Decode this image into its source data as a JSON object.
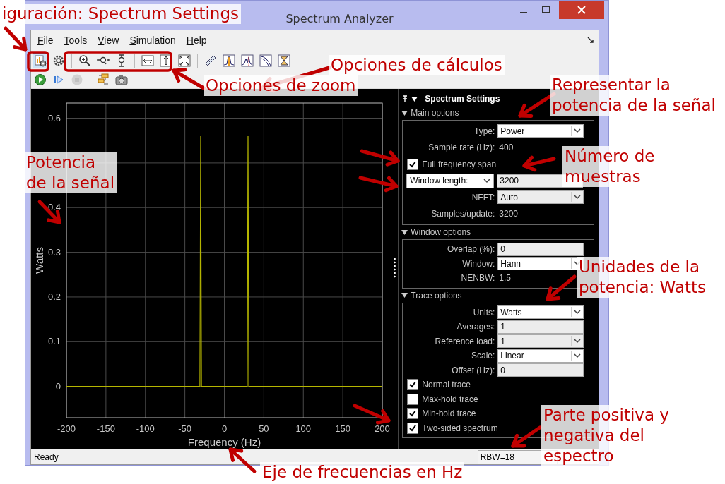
{
  "window": {
    "title": "Spectrum Analyzer"
  },
  "menu": [
    {
      "label": "File"
    },
    {
      "label": "Tools"
    },
    {
      "label": "View"
    },
    {
      "label": "Simulation"
    },
    {
      "label": "Help"
    }
  ],
  "toolbar": {
    "groups": [
      {
        "buttons": [
          {
            "kind": "settings-page",
            "selected": true
          },
          {
            "kind": "gear",
            "selected": false
          }
        ]
      },
      {
        "buttons": [
          {
            "kind": "zoom-in",
            "selected": false
          },
          {
            "kind": "zoom-x",
            "selected": false
          },
          {
            "kind": "zoom-y",
            "selected": false
          }
        ]
      },
      {
        "buttons": [
          {
            "kind": "fit-x",
            "selected": false
          },
          {
            "kind": "fit-y",
            "selected": false
          },
          {
            "kind": "fit-all",
            "selected": false
          }
        ]
      },
      {
        "buttons": [
          {
            "kind": "ruler",
            "selected": false
          },
          {
            "kind": "peak",
            "selected": false
          },
          {
            "kind": "spectrum",
            "selected": false
          },
          {
            "kind": "curve",
            "selected": false
          },
          {
            "kind": "hourglass",
            "selected": false
          }
        ]
      }
    ]
  },
  "run_toolbar": {
    "groups": [
      {
        "buttons": [
          {
            "kind": "run",
            "disabled": false
          },
          {
            "kind": "step",
            "disabled": false
          },
          {
            "kind": "stop",
            "disabled": true
          }
        ]
      },
      {
        "buttons": [
          {
            "kind": "blocks",
            "disabled": false
          },
          {
            "kind": "camera",
            "disabled": false
          }
        ]
      }
    ]
  },
  "plot": {
    "chart_data": {
      "type": "line",
      "xlabel": "Frequency (Hz)",
      "ylabel": "Watts",
      "x": [
        -200,
        -31,
        -30,
        -29,
        29,
        30,
        31,
        200
      ],
      "series": [
        {
          "color": "#b5b500",
          "values": [
            0,
            0,
            0.56,
            0,
            0,
            0.56,
            0,
            0
          ]
        }
      ],
      "xlim": [
        -200,
        200
      ],
      "ylim": [
        -0.07,
        0.634
      ],
      "xticks": [
        -200,
        -150,
        -100,
        -50,
        0,
        50,
        100,
        150,
        200
      ],
      "yticks": [
        0,
        0.1,
        0.2,
        0.3,
        0.4,
        0.6
      ],
      "grid": true
    }
  },
  "settings": {
    "title": "Spectrum Settings",
    "sections": [
      {
        "title": "Main options",
        "expanded": true,
        "rows": [
          {
            "kind": "dropdown",
            "label": "Type:",
            "value": "Power"
          },
          {
            "kind": "readout",
            "label": "Sample rate (Hz):",
            "value": "400"
          },
          {
            "kind": "checkbox",
            "label": "Full frequency span",
            "checked": true
          },
          {
            "kind": "dropdown-input",
            "label": "Window length:",
            "value": "3200"
          },
          {
            "kind": "combo",
            "label": "NFFT:",
            "value": "Auto"
          },
          {
            "kind": "readout",
            "label": "Samples/update:",
            "value": "3200"
          }
        ]
      },
      {
        "title": "Window options",
        "expanded": true,
        "rows": [
          {
            "kind": "input",
            "label": "Overlap (%):",
            "value": "0"
          },
          {
            "kind": "dropdown",
            "label": "Window:",
            "value": "Hann"
          },
          {
            "kind": "readout",
            "label": "NENBW:",
            "value": "1.5"
          }
        ]
      },
      {
        "title": "Trace options",
        "expanded": true,
        "rows": [
          {
            "kind": "dropdown",
            "label": "Units:",
            "value": "Watts"
          },
          {
            "kind": "input",
            "label": "Averages:",
            "value": "1"
          },
          {
            "kind": "combo",
            "label": "Reference load:",
            "value": "1"
          },
          {
            "kind": "dropdown",
            "label": "Scale:",
            "value": "Linear"
          },
          {
            "kind": "input",
            "label": "Offset (Hz):",
            "value": "0"
          },
          {
            "kind": "checkbox",
            "label": "Normal trace",
            "checked": true
          },
          {
            "kind": "checkbox",
            "label": "Max-hold trace",
            "checked": false
          },
          {
            "kind": "checkbox",
            "label": "Min-hold trace",
            "checked": true
          },
          {
            "kind": "checkbox",
            "label": "Two-sided spectrum",
            "checked": true
          }
        ]
      }
    ]
  },
  "status_bar": {
    "status": "Ready",
    "readout": "RBW=18"
  },
  "annotations": [
    {
      "lines": [
        "iguración: Spectrum Settings"
      ]
    },
    {
      "lines": [
        "Opciones de cálculos"
      ]
    },
    {
      "lines": [
        "Opciones de zoom"
      ]
    },
    {
      "lines": [
        "Representar la",
        "potencia de la señal"
      ]
    },
    {
      "lines": [
        "Potencia",
        "de la señal"
      ]
    },
    {
      "lines": [
        "Número de",
        "muestras"
      ]
    },
    {
      "lines": [
        "Unidades de la",
        "potencia: Watts"
      ]
    },
    {
      "lines": [
        "Parte positiva y",
        "negativa del",
        "espectro"
      ]
    },
    {
      "lines": [
        "Eje de frecuencias en Hz"
      ]
    }
  ]
}
